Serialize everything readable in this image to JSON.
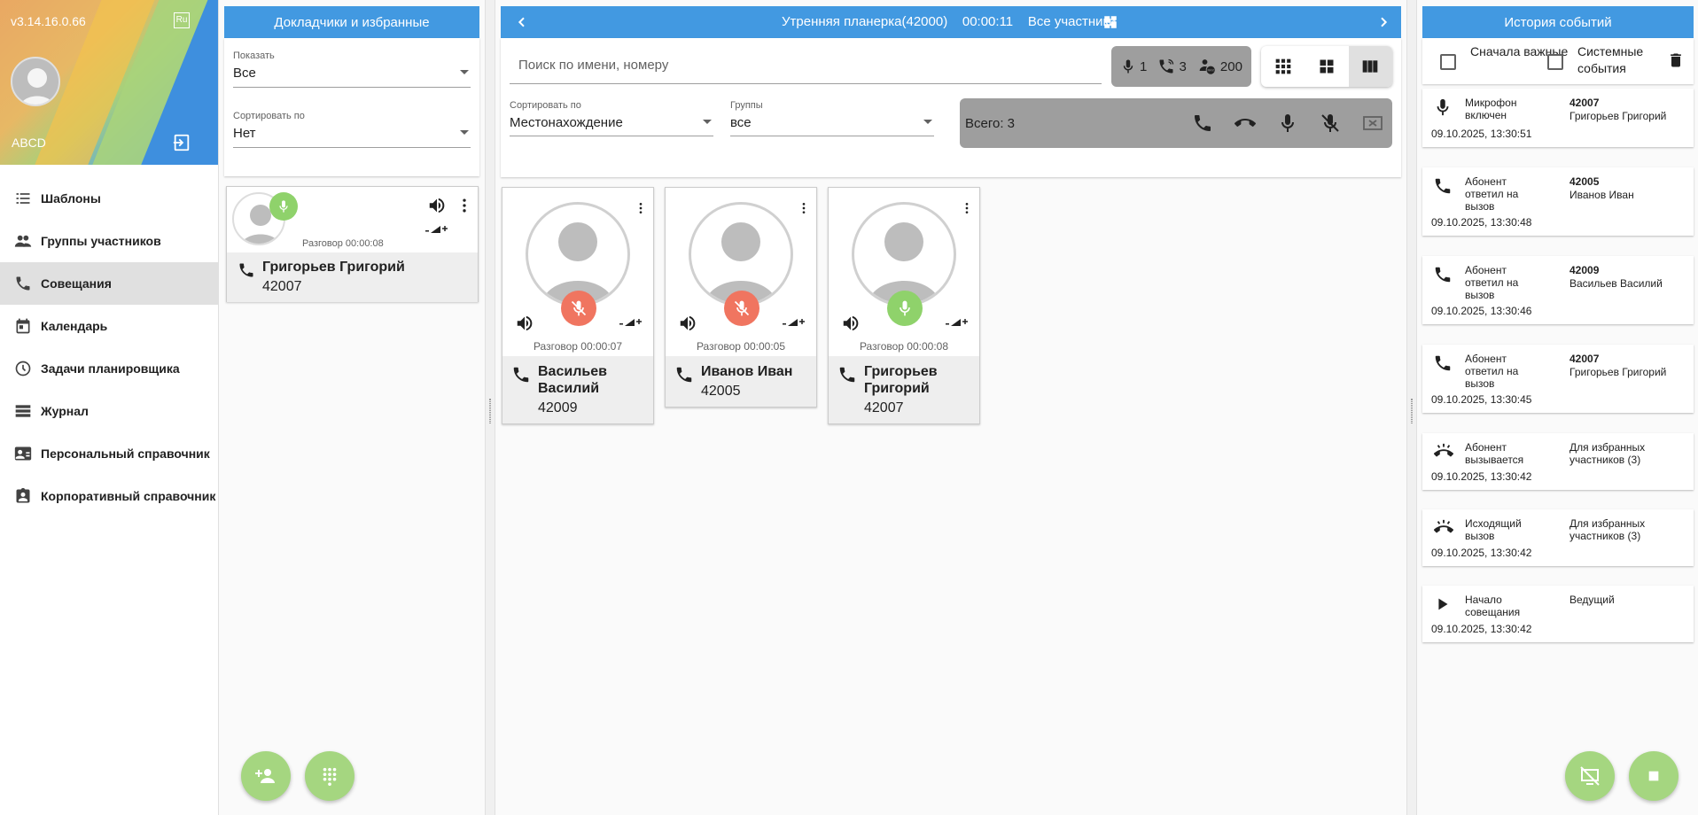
{
  "sidebar": {
    "version": "v3.14.16.0.66",
    "lang": "Ru",
    "user": "ABCD",
    "items": [
      {
        "label": "Шаблоны",
        "icon": "list-icon"
      },
      {
        "label": "Группы участников",
        "icon": "people-icon"
      },
      {
        "label": "Совещания",
        "icon": "phone-icon",
        "active": true
      },
      {
        "label": "Календарь",
        "icon": "calendar-icon"
      },
      {
        "label": "Задачи планировщика",
        "icon": "clock-icon"
      },
      {
        "label": "Журнал",
        "icon": "log-icon"
      },
      {
        "label": "Персональный справочник",
        "icon": "contact-card-icon"
      },
      {
        "label": "Корпоративный справочник",
        "icon": "corporate-contacts-icon"
      }
    ]
  },
  "speakers": {
    "title": "Докладчики и избранные",
    "show_label": "Показать",
    "show_value": "Все",
    "sort_label": "Сортировать по",
    "sort_value": "Нет",
    "card": {
      "talk": "Разговор 00:00:08",
      "name": "Григорьев Григорий",
      "number": "42007"
    }
  },
  "conference": {
    "title": "Утренняя планерка(42000)",
    "timer": "00:00:11",
    "scope": "Все участники",
    "search_placeholder": "Поиск по имени, номеру",
    "stats": {
      "mics": "1",
      "calls": "3",
      "max": "200"
    },
    "sort_label": "Сортировать по",
    "sort_value": "Местонахождение",
    "groups_label": "Группы",
    "groups_value": "все",
    "total": "Всего: 3",
    "participants": [
      {
        "name": "Васильев Василий",
        "number": "42009",
        "talk": "Разговор 00:00:07",
        "mic": "off"
      },
      {
        "name": "Иванов Иван",
        "number": "42005",
        "talk": "Разговор 00:00:05",
        "mic": "off"
      },
      {
        "name": "Григорьев Григорий",
        "number": "42007",
        "talk": "Разговор 00:00:08",
        "mic": "on"
      }
    ]
  },
  "events": {
    "title": "История событий",
    "important_first": "Сначала важные",
    "system_events": "Системные события",
    "items": [
      {
        "type": "Микрофон включен",
        "number": "42007",
        "who": "Григорьев Григорий",
        "time": "09.10.2025, 13:30:51",
        "icon": "mic-icon"
      },
      {
        "type": "Абонент ответил на вызов",
        "number": "42005",
        "who": "Иванов Иван",
        "time": "09.10.2025, 13:30:48",
        "icon": "phone-icon"
      },
      {
        "type": "Абонент ответил на вызов",
        "number": "42009",
        "who": "Васильев Василий",
        "time": "09.10.2025, 13:30:46",
        "icon": "phone-icon"
      },
      {
        "type": "Абонент ответил на вызов",
        "number": "42007",
        "who": "Григорьев Григорий",
        "time": "09.10.2025, 13:30:45",
        "icon": "phone-icon"
      },
      {
        "type": "Абонент вызывается",
        "number": "",
        "who": "Для избранных участников (3)",
        "time": "09.10.2025, 13:30:42",
        "icon": "ringing-icon"
      },
      {
        "type": "Исходящий вызов",
        "number": "",
        "who": "Для избранных участников (3)",
        "time": "09.10.2025, 13:30:42",
        "icon": "ringing-icon"
      },
      {
        "type": "Начало совещания",
        "number": "",
        "who": "Ведущий",
        "time": "09.10.2025, 13:30:42",
        "icon": "play-icon"
      }
    ]
  },
  "colors": {
    "accent": "#4299e1",
    "mic_on": "#8fd26b",
    "mic_off": "#f07560",
    "fab": "#a5d680"
  }
}
